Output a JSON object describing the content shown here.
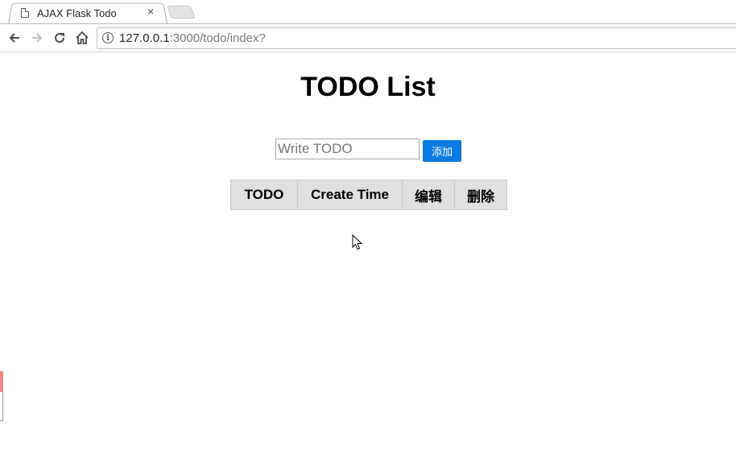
{
  "browser": {
    "tab": {
      "title": "AJAX Flask Todo",
      "close_label": "×"
    },
    "address": {
      "host": "127.0.0.1",
      "path": ":3000/todo/index?",
      "info_symbol": "i"
    }
  },
  "page": {
    "title": "TODO List",
    "form": {
      "input_value": "",
      "input_placeholder": "Write TODO",
      "add_button_label": "添加"
    },
    "table": {
      "headers": [
        "TODO",
        "Create Time",
        "编辑",
        "删除"
      ],
      "rows": []
    }
  },
  "colors": {
    "accent_button": "#0a7ce3",
    "table_header_bg": "#e0e0e0"
  },
  "icons": {
    "back": "arrow-left-icon",
    "forward": "arrow-right-icon",
    "reload": "reload-icon",
    "home": "home-icon"
  }
}
